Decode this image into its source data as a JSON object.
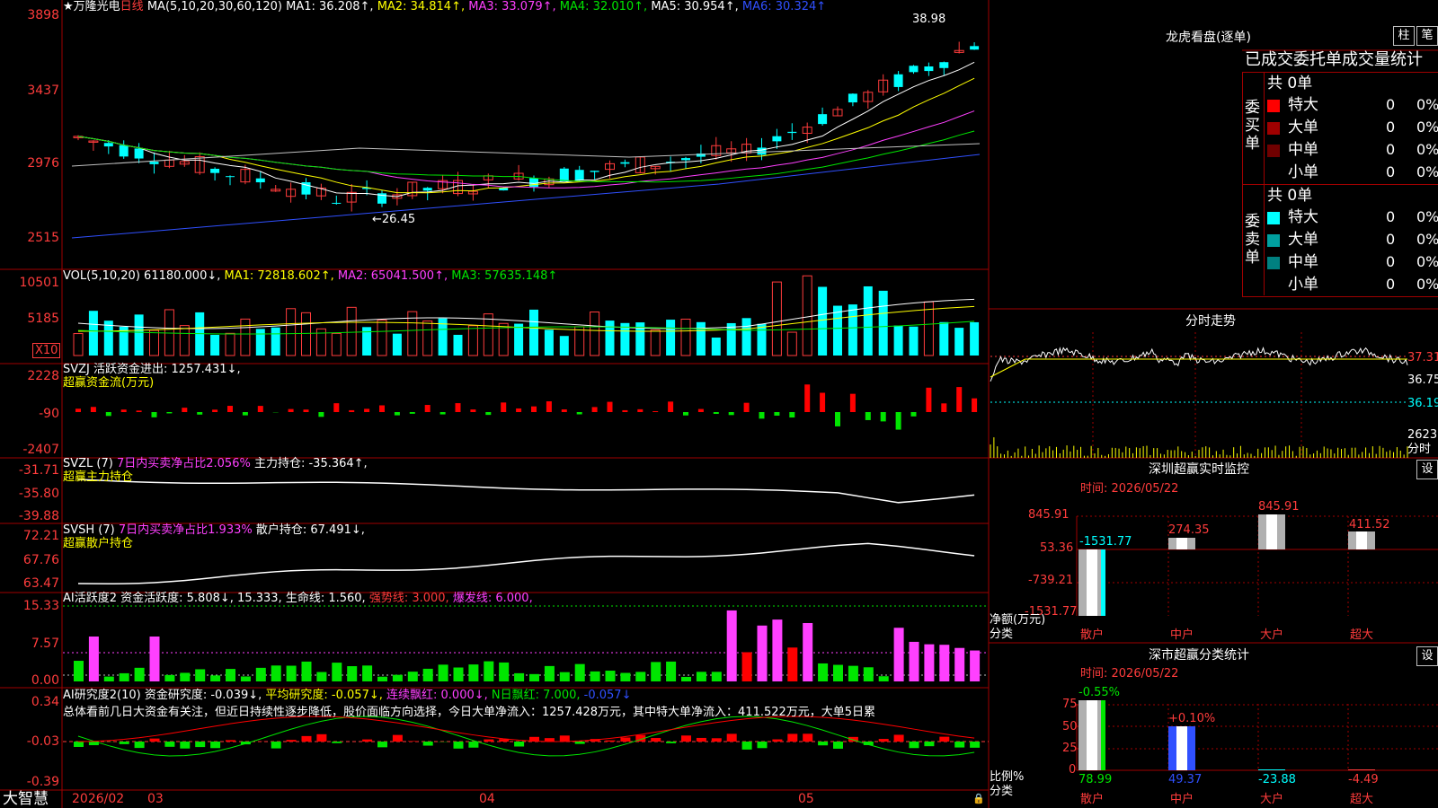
{
  "header": {
    "star": "★",
    "stock_name": "万隆光电",
    "period": "日线",
    "ma_title": "MA(5,10,20,30,60,120)",
    "ma1": "MA1: 36.208↑,",
    "ma2": "MA2: 34.814↑,",
    "ma3": "MA3: 33.079↑,",
    "ma4": "MA4: 32.010↑,",
    "ma5": "MA5: 30.954↑,",
    "ma6": "MA6: 30.324↑"
  },
  "price_axis": [
    "3898",
    "3437",
    "2976",
    "2515"
  ],
  "price_annotations": {
    "high": "38.98",
    "low": "←26.45"
  },
  "vol_header": {
    "title": "VOL(5,10,20)",
    "value": "61180.000↓,",
    "ma1": "MA1: 72818.602↑,",
    "ma2": "MA2: 65041.500↑,",
    "ma3": "MA3: 57635.148↑"
  },
  "vol_axis": [
    "10501",
    "5185"
  ],
  "vol_unit": "X10",
  "svzj": {
    "title": "SVZJ  活跃资金进出: 1257.431↓,",
    "subtitle": "超赢资金流(万元)",
    "axis": [
      "2228",
      "-90",
      "-2407"
    ]
  },
  "svzl": {
    "title": "SVZL (7)",
    "part2": "7日内买卖净占比2.056%",
    "part3": "主力持仓: -35.364↑,",
    "subtitle": "超赢主力持仓",
    "axis": [
      "-31.71",
      "-35.80",
      "-39.88"
    ]
  },
  "svsh": {
    "title": "SVSH (7)",
    "part2": "7日内买卖净占比1.933%",
    "part3": "散户持仓: 67.491↓,",
    "subtitle": "超赢散户持仓",
    "axis": [
      "72.21",
      "67.76",
      "63.47"
    ]
  },
  "ai_active": {
    "title": "AI活跃度2",
    "t1": "资金活跃度: 5.808↓,",
    "t2": "15.333,",
    "t3": "生命线: 1.560,",
    "t4": "强势线: 3.000,",
    "t5": "爆发线: 6.000,",
    "axis": [
      "15.33",
      "7.57",
      "0.00"
    ]
  },
  "ai_research": {
    "title": "AI研究度2(10)",
    "t1": "资金研究度: -0.039↓,",
    "t2": "平均研究度: -0.057↓,",
    "t3": "连续飘红: 0.000↓,",
    "t4": "N日飘红: 7.000,",
    "t5": "-0.057↓",
    "desc": "总体看前几日大资金有关注，但近日持续性逐步降低，股价面临方向选择，今日大单净流入：1257.428万元，其中特大单净流入：411.522万元，大单5日累",
    "axis": [
      "0.34",
      "-0.03",
      "-0.39"
    ]
  },
  "bottom": {
    "brand": "大智慧",
    "d1": "2026/02",
    "d2": "03",
    "d3": "04",
    "d4": "05"
  },
  "right": {
    "lhb_title": "龙虎看盘(逐单)",
    "btn_zhu": "柱",
    "btn_bi": "笔",
    "tabs_title": "已成交委托单成交量统计",
    "buy_label": "委买单",
    "sell_label": "委卖单",
    "buy_total": "共 0单",
    "sell_total": "共 0单",
    "buy_rows": [
      {
        "name": "特大",
        "count": "0",
        "pct": "0%",
        "color": "#ff0000"
      },
      {
        "name": "大单",
        "count": "0",
        "pct": "0%",
        "color": "#a00000"
      },
      {
        "name": "中单",
        "count": "0",
        "pct": "0%",
        "color": "#700000"
      },
      {
        "name": "小单",
        "count": "0",
        "pct": "0%",
        "color": "#000000"
      }
    ],
    "sell_rows": [
      {
        "name": "特大",
        "count": "0",
        "pct": "0%",
        "color": "#00ffff"
      },
      {
        "name": "大单",
        "count": "0",
        "pct": "0%",
        "color": "#00a0a0"
      },
      {
        "name": "中单",
        "count": "0",
        "pct": "0%",
        "color": "#008080"
      },
      {
        "name": "小单",
        "count": "0",
        "pct": "0%",
        "color": "#000000"
      }
    ],
    "intraday_title": "分时走势",
    "intraday_axis": [
      "37.31",
      "36.75",
      "36.19"
    ],
    "intraday_vol": "2623",
    "intraday_unit": "分时",
    "monitor_title": "深圳超赢实时监控",
    "monitor_btn": "设",
    "monitor_time": "时间: 2026/05/22",
    "monitor_axis": [
      "845.91",
      "53.36",
      "-739.21",
      "-1531.77"
    ],
    "monitor_ylabel": "净额(万元)",
    "monitor_xlabel": "分类",
    "monitor_cats": [
      "散户",
      "中户",
      "大户",
      "超大"
    ],
    "monitor_values": [
      "-1531.77",
      "274.35",
      "845.91",
      "411.52"
    ],
    "class_title": "深市超赢分类统计",
    "class_btn": "设",
    "class_time": "时间: 2026/05/22",
    "class_axis": [
      "75",
      "50",
      "25",
      "0"
    ],
    "class_ylabel": "比例%",
    "class_xlabel": "分类",
    "class_top": [
      "-0.55%",
      "+0.10%"
    ],
    "class_cats": [
      "散户",
      "中户",
      "大户",
      "超大"
    ],
    "class_values": [
      "78.99",
      "49.37",
      "-23.88",
      "-4.49"
    ]
  }
}
